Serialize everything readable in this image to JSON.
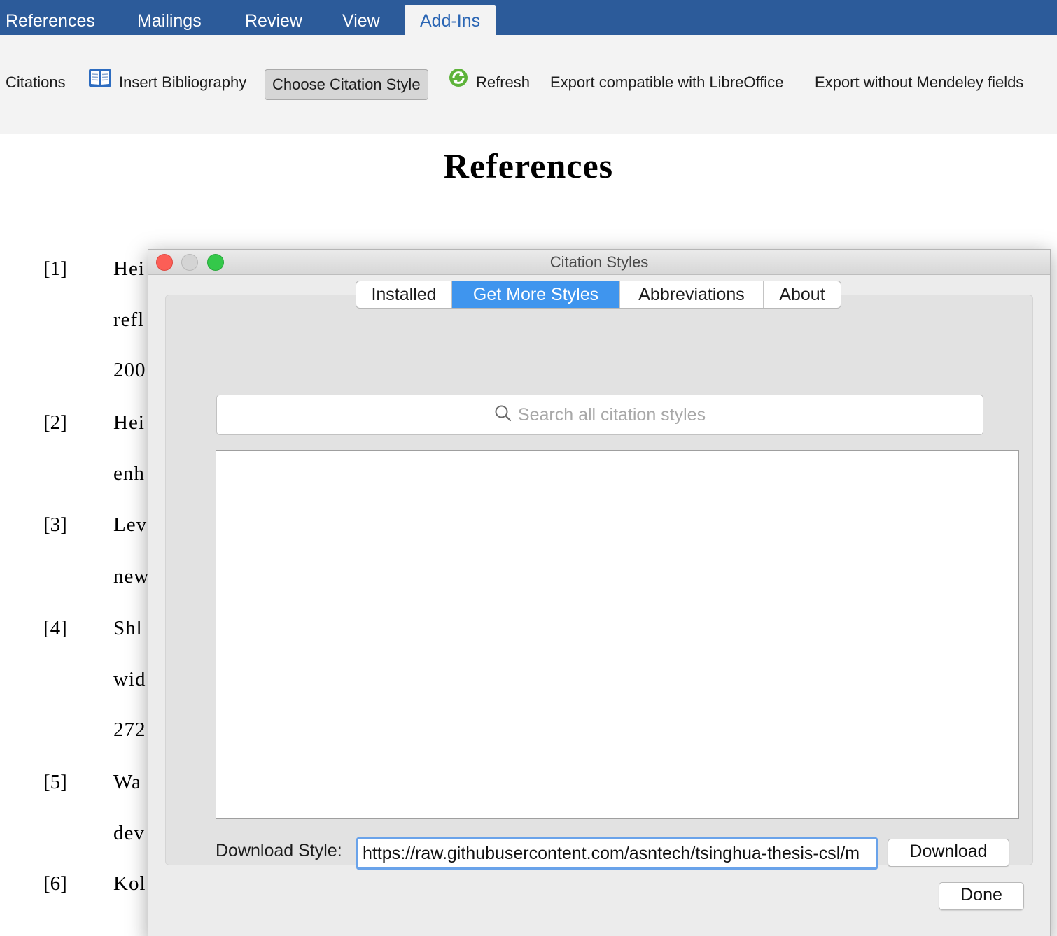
{
  "ribbon": {
    "tabs": [
      {
        "label": "References",
        "active": false
      },
      {
        "label": "Mailings",
        "active": false
      },
      {
        "label": "Review",
        "active": false
      },
      {
        "label": "View",
        "active": false
      },
      {
        "label": "Add-Ins",
        "active": true
      }
    ],
    "toolbar": {
      "citations_label": "Citations",
      "insert_bibliography_label": "Insert Bibliography",
      "choose_style_label": "Choose Citation Style",
      "refresh_label": "Refresh",
      "export_libreoffice_label": "Export compatible with LibreOffice",
      "export_without_fields_label": "Export without Mendeley fields"
    }
  },
  "document": {
    "title": "References",
    "refs": [
      {
        "num": "[1]",
        "lines": [
          "Hei",
          "refl",
          "200"
        ]
      },
      {
        "num": "[2]",
        "lines": [
          "Hei",
          "enh"
        ]
      },
      {
        "num": "[3]",
        "lines": [
          "Lev",
          "new"
        ]
      },
      {
        "num": "[4]",
        "lines": [
          "Shl",
          "wid",
          "272"
        ]
      },
      {
        "num": "[5]",
        "lines": [
          "Wa",
          "dev"
        ]
      },
      {
        "num": "[6]",
        "lines": [
          "Kol"
        ]
      }
    ]
  },
  "dialog": {
    "title": "Citation Styles",
    "tabs": [
      {
        "label": "Installed",
        "active": false
      },
      {
        "label": "Get More Styles",
        "active": true
      },
      {
        "label": "Abbreviations",
        "active": false
      },
      {
        "label": "About",
        "active": false
      }
    ],
    "search_placeholder": "Search all citation styles",
    "download_label": "Download Style:",
    "download_url": "https://raw.githubusercontent.com/asntech/tsinghua-thesis-csl/m",
    "download_button": "Download",
    "done_button": "Done"
  },
  "colors": {
    "ribbon_blue": "#2c5b9a",
    "active_tab_text": "#2b66b4",
    "segment_active": "#3f95ee",
    "input_focus": "#6aa3ea"
  }
}
